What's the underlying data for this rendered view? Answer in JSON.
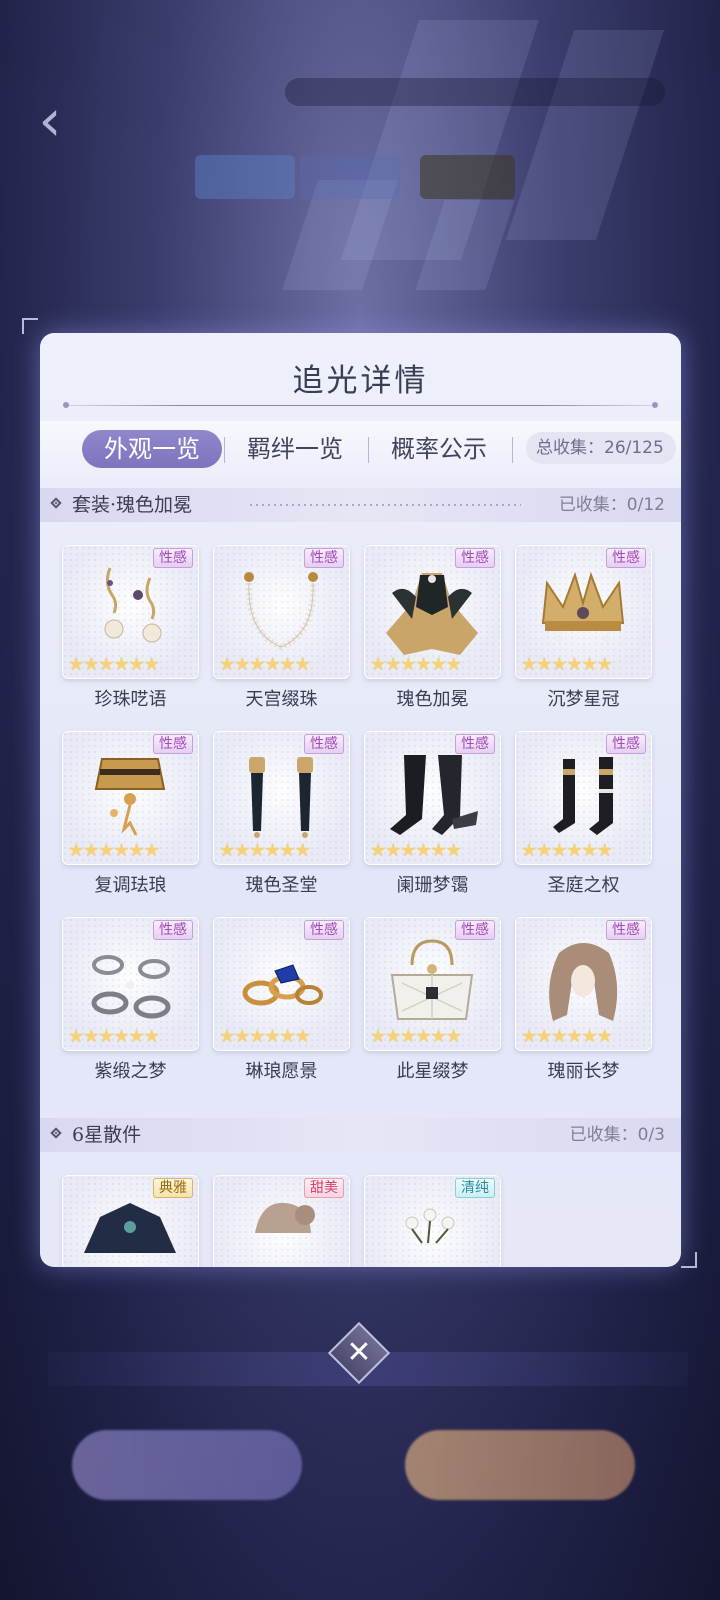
{
  "panel": {
    "title": "追光详情"
  },
  "tabs": [
    {
      "label": "外观一览",
      "active": true
    },
    {
      "label": "羁绊一览",
      "active": false
    },
    {
      "label": "概率公示",
      "active": false
    }
  ],
  "total_collected": "总收集：26/125",
  "section1": {
    "title": "套装·瑰色加冕",
    "collected": "已收集：0/12",
    "items": [
      {
        "name": "珍珠呓语",
        "tag": "性感",
        "stars": "★★★★★★",
        "icon": "pearl-earrings-icon"
      },
      {
        "name": "天宫缀珠",
        "tag": "性感",
        "stars": "★★★★★★",
        "icon": "pearl-necklace-icon"
      },
      {
        "name": "瑰色加冕",
        "tag": "性感",
        "stars": "★★★★★★",
        "icon": "gown-icon"
      },
      {
        "name": "沉梦星冠",
        "tag": "性感",
        "stars": "★★★★★★",
        "icon": "crown-icon"
      },
      {
        "name": "复调珐琅",
        "tag": "性感",
        "stars": "★★★★★★",
        "icon": "enamel-collar-icon"
      },
      {
        "name": "瑰色圣堂",
        "tag": "性感",
        "stars": "★★★★★★",
        "icon": "gloves-icon"
      },
      {
        "name": "阑珊梦霭",
        "tag": "性感",
        "stars": "★★★★★★",
        "icon": "stockings-icon"
      },
      {
        "name": "圣庭之权",
        "tag": "性感",
        "stars": "★★★★★★",
        "icon": "boots-icon"
      },
      {
        "name": "紫缎之梦",
        "tag": "性感",
        "stars": "★★★★★★",
        "icon": "bracelets-icon"
      },
      {
        "name": "琳琅愿景",
        "tag": "性感",
        "stars": "★★★★★★",
        "icon": "rings-icon"
      },
      {
        "name": "此星缀梦",
        "tag": "性感",
        "stars": "★★★★★★",
        "icon": "handbag-icon"
      },
      {
        "name": "瑰丽长梦",
        "tag": "性感",
        "stars": "★★★★★★",
        "icon": "long-hair-icon"
      }
    ]
  },
  "section2": {
    "title": "6星散件",
    "collected": "已收集：0/3",
    "items": [
      {
        "tag": "典雅",
        "icon": "dark-coat-icon"
      },
      {
        "tag": "甜美",
        "icon": "hair-bun-icon"
      },
      {
        "tag": "清纯",
        "icon": "white-flowers-icon"
      }
    ]
  },
  "colors": {
    "accent": "#7c74bd",
    "panel_bg": "#eef0fb",
    "star": "#f5d27a"
  }
}
